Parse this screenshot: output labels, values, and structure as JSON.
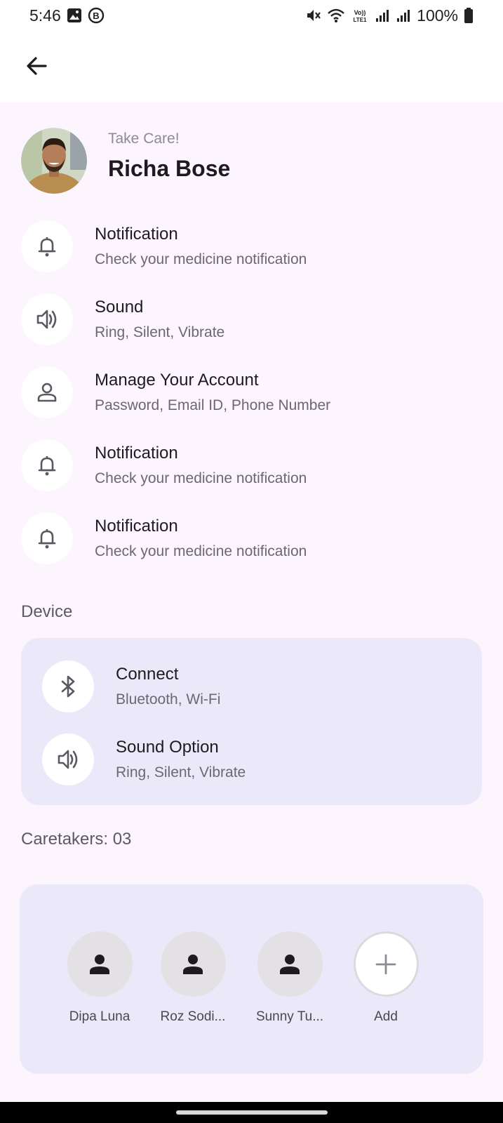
{
  "status_bar": {
    "time": "5:46",
    "battery": "100%",
    "left_icons": [
      "gallery-icon",
      "b-badge-icon"
    ],
    "right_icons": [
      "mute-icon",
      "wifi-icon",
      "volte-icon",
      "signal-icon",
      "signal-icon",
      "battery-icon"
    ]
  },
  "profile": {
    "greeting": "Take Care!",
    "name": "Richa Bose"
  },
  "settings": [
    {
      "icon": "bell-icon",
      "title": "Notification",
      "subtitle": "Check your medicine notification"
    },
    {
      "icon": "speaker-icon",
      "title": "Sound",
      "subtitle": "Ring, Silent, Vibrate"
    },
    {
      "icon": "person-icon",
      "title": "Manage Your Account",
      "subtitle": "Password, Email ID, Phone Number"
    },
    {
      "icon": "bell-icon",
      "title": "Notification",
      "subtitle": "Check your medicine notification"
    },
    {
      "icon": "bell-icon",
      "title": "Notification",
      "subtitle": "Check your medicine notification"
    }
  ],
  "device": {
    "label": "Device",
    "items": [
      {
        "icon": "bluetooth-icon",
        "title": "Connect",
        "subtitle": "Bluetooth, Wi-Fi"
      },
      {
        "icon": "speaker-icon",
        "title": "Sound Option",
        "subtitle": "Ring, Silent, Vibrate"
      }
    ]
  },
  "caretakers": {
    "label": "Caretakers: 03",
    "people": [
      {
        "name": "Dipa Luna"
      },
      {
        "name": "Roz Sodi..."
      },
      {
        "name": "Sunny Tu..."
      }
    ],
    "add_label": "Add"
  },
  "colors": {
    "background": "#fcf5fd",
    "card": "#ebe9f9",
    "icon_circle": "#ffffff",
    "title_text": "#1d1b20",
    "subtitle_text": "#6b6870"
  }
}
